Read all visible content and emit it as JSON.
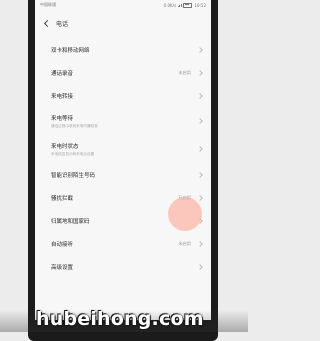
{
  "status_bar": {
    "left": "中国联通",
    "speed": "0.0K/s",
    "time": "10:52"
  },
  "header": {
    "title": "电话"
  },
  "settings": [
    {
      "label": "双卡和移动网络",
      "value": "",
      "sub": ""
    },
    {
      "label": "通话录音",
      "value": "未启用",
      "sub": ""
    },
    {
      "label": "来电转接",
      "value": "",
      "sub": ""
    },
    {
      "label": "来电等待",
      "value": "",
      "sub": "通话过程中收到来电时通知我"
    },
    {
      "label": "来电时状态",
      "value": "",
      "sub": "来电信息显示和来电后设置"
    },
    {
      "label": "智能识别陌生号码",
      "value": "",
      "sub": ""
    },
    {
      "label": "骚扰拦截",
      "value": "已启用",
      "sub": ""
    },
    {
      "label": "归属地和国家码",
      "value": "",
      "sub": ""
    },
    {
      "label": "自动接听",
      "value": "未启用",
      "sub": ""
    },
    {
      "label": "高级设置",
      "value": "",
      "sub": ""
    }
  ],
  "watermark": "hubeihong.com"
}
